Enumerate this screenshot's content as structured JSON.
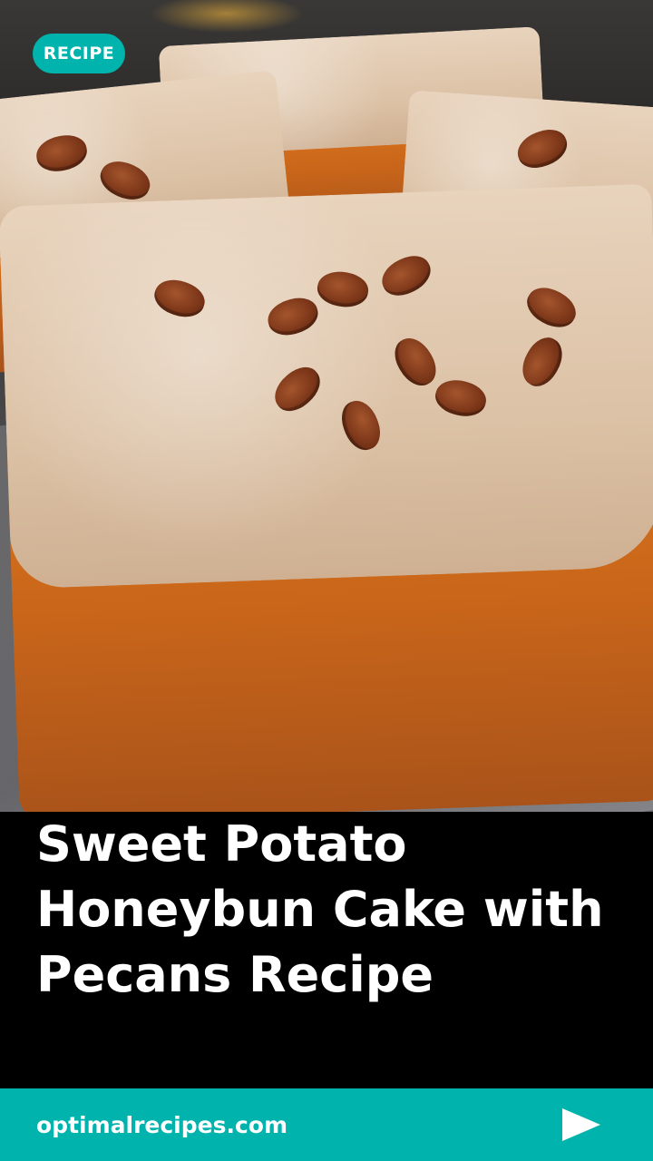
{
  "badge": {
    "label": "RECIPE",
    "color": "#00b3ad"
  },
  "hero": {
    "image_subject": "sweet potato honeybun cake slices with glaze and pecans"
  },
  "title": "Sweet Potato Honeybun Cake with Pecans Recipe",
  "footer": {
    "site": "optimalrecipes.com",
    "background": "#00b3ad",
    "next_icon": "play-arrow-icon"
  }
}
